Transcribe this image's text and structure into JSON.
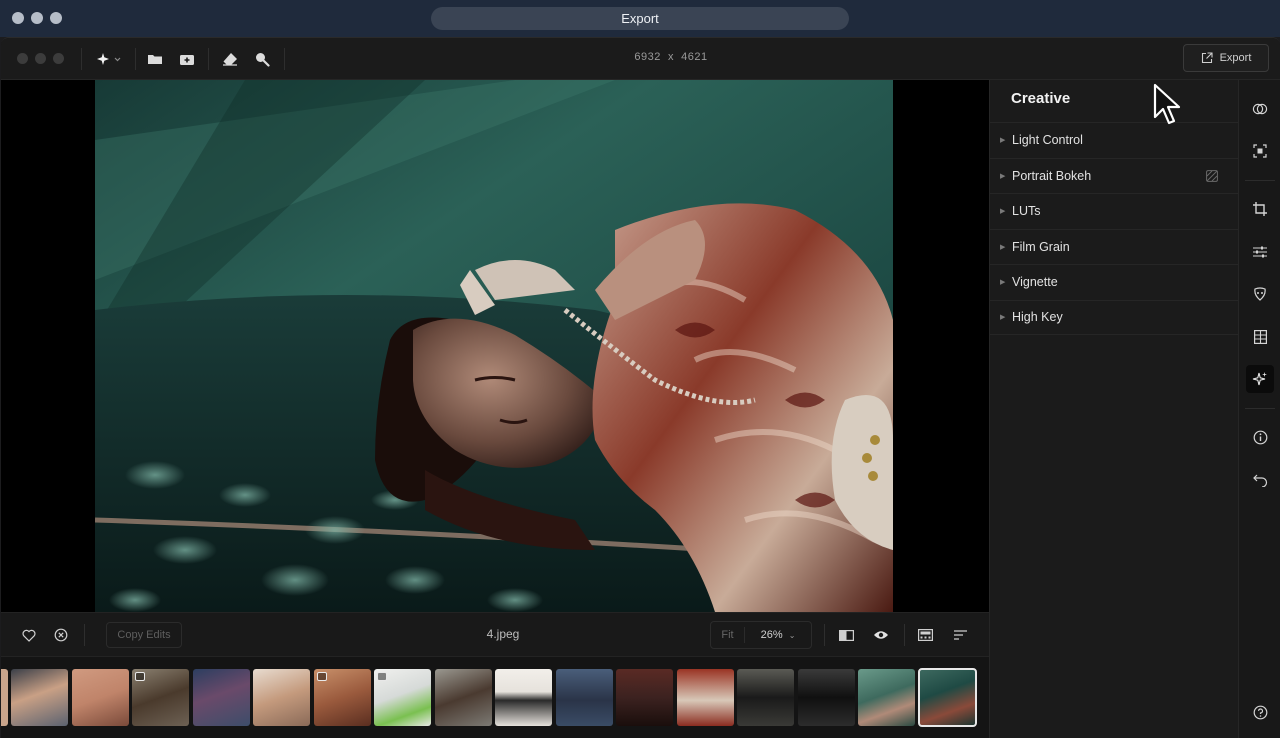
{
  "window": {
    "title": "Export"
  },
  "toolbar": {
    "image_dimensions": "6932  x  4621",
    "export_label": "Export",
    "icons": [
      "magic-wand-icon",
      "folder-icon",
      "import-icon",
      "eraser-icon",
      "search-icon"
    ]
  },
  "panel": {
    "title": "Creative",
    "items": [
      {
        "label": "Light Control"
      },
      {
        "label": "Portrait Bokeh"
      },
      {
        "label": "LUTs"
      },
      {
        "label": "Film Grain"
      },
      {
        "label": "Vignette"
      },
      {
        "label": "High Key"
      }
    ]
  },
  "rail": {
    "icons": [
      "color-circles-icon",
      "face-select-icon",
      "crop-icon",
      "sliders-icon",
      "mask-icon",
      "grid-icon",
      "sparkle-icon",
      "info-icon",
      "undo-icon",
      "help-icon"
    ],
    "active": "sparkle-icon"
  },
  "bottom": {
    "copy_edits_label": "Copy Edits",
    "filename": "4.jpeg",
    "fit_label": "Fit",
    "zoom": "26%"
  },
  "filmstrip": {
    "count": 16,
    "selected_index": 15,
    "colors": [
      "#c9a58c",
      "#5b6270",
      "#c0846a",
      "#6d6154",
      "#3d4d6a",
      "#c49a7d",
      "#9a5a3d",
      "#d6dad8",
      "#7c7a74",
      "#e6e2dc",
      "#3a4c66",
      "#3c2220",
      "#8a2c20",
      "#3a3a36",
      "#2c2c2c",
      "#3e6a5e",
      "#2e4a46"
    ]
  },
  "colors": {
    "accent_active_rail": "#0b0b0b",
    "wall_teal": "#1f4a44"
  }
}
